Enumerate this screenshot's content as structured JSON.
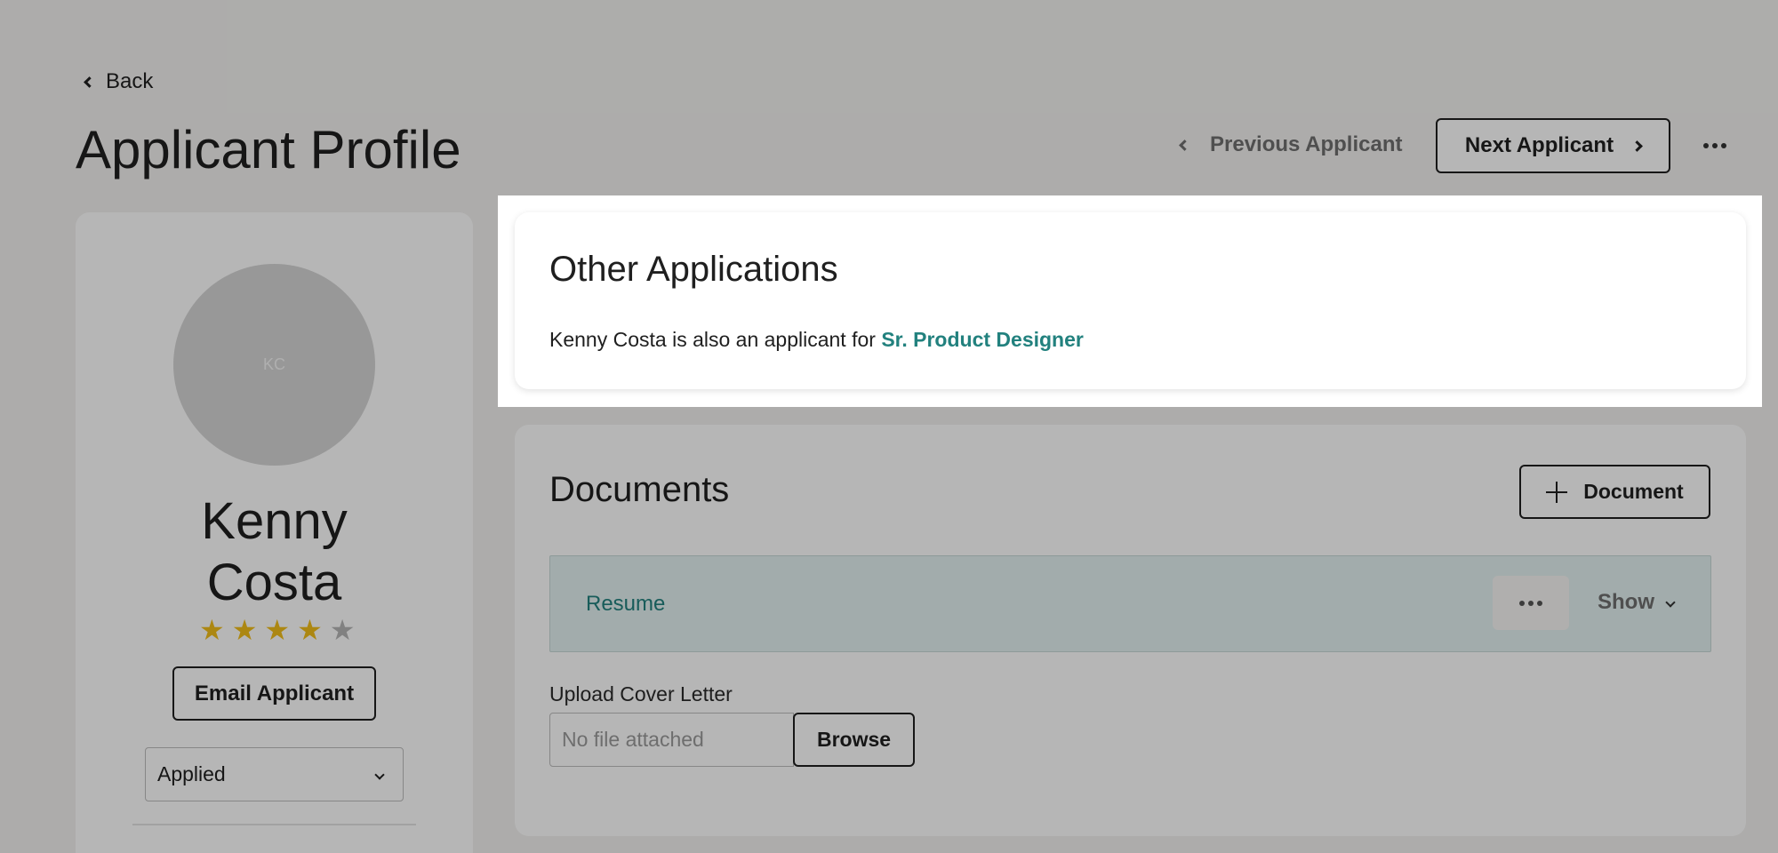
{
  "header": {
    "back_label": "Back",
    "title": "Applicant Profile",
    "previous_label": "Previous Applicant",
    "next_label": "Next Applicant"
  },
  "profile": {
    "initials": "KC",
    "name": "Kenny Costa",
    "rating": 4,
    "rating_max": 5,
    "star_color": "#f2be1a",
    "star_empty_color": "#b5b5b5",
    "email_button": "Email Applicant",
    "status": "Applied"
  },
  "other_applications": {
    "title": "Other Applications",
    "text": "Kenny Costa is also an applicant for",
    "link": "Sr. Product Designer"
  },
  "documents": {
    "title": "Documents",
    "add_button": "Document",
    "items": [
      {
        "label": "Resume",
        "toggle": "Show"
      }
    ],
    "upload_label": "Upload Cover Letter",
    "upload_placeholder": "No file attached",
    "browse_button": "Browse"
  },
  "colors": {
    "accent": "#22817e",
    "background": "#f3f2f0"
  }
}
